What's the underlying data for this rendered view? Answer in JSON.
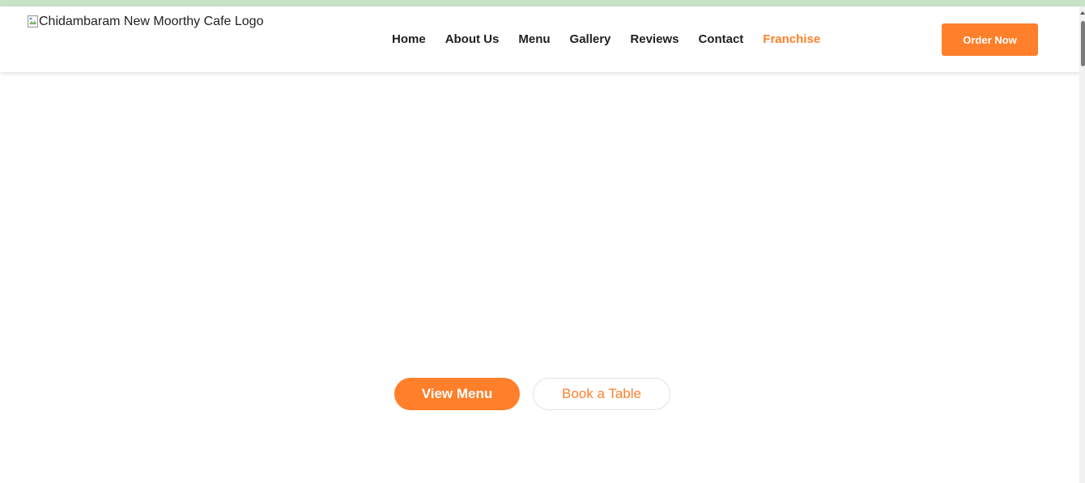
{
  "header": {
    "logo_alt": "Chidambaram New Moorthy Cafe Logo",
    "nav": [
      {
        "label": "Home"
      },
      {
        "label": "About Us"
      },
      {
        "label": "Menu"
      },
      {
        "label": "Gallery"
      },
      {
        "label": "Reviews"
      },
      {
        "label": "Contact"
      },
      {
        "label": "Franchise"
      }
    ],
    "order_button": "Order Now"
  },
  "hero": {
    "primary_button": "View Menu",
    "secondary_button": "Book a Table"
  },
  "colors": {
    "accent": "#ff7f2a",
    "top_strip": "#c8e3c6",
    "text": "#1f1f1f"
  },
  "icons": {
    "logo_placeholder": "broken-image-icon"
  }
}
